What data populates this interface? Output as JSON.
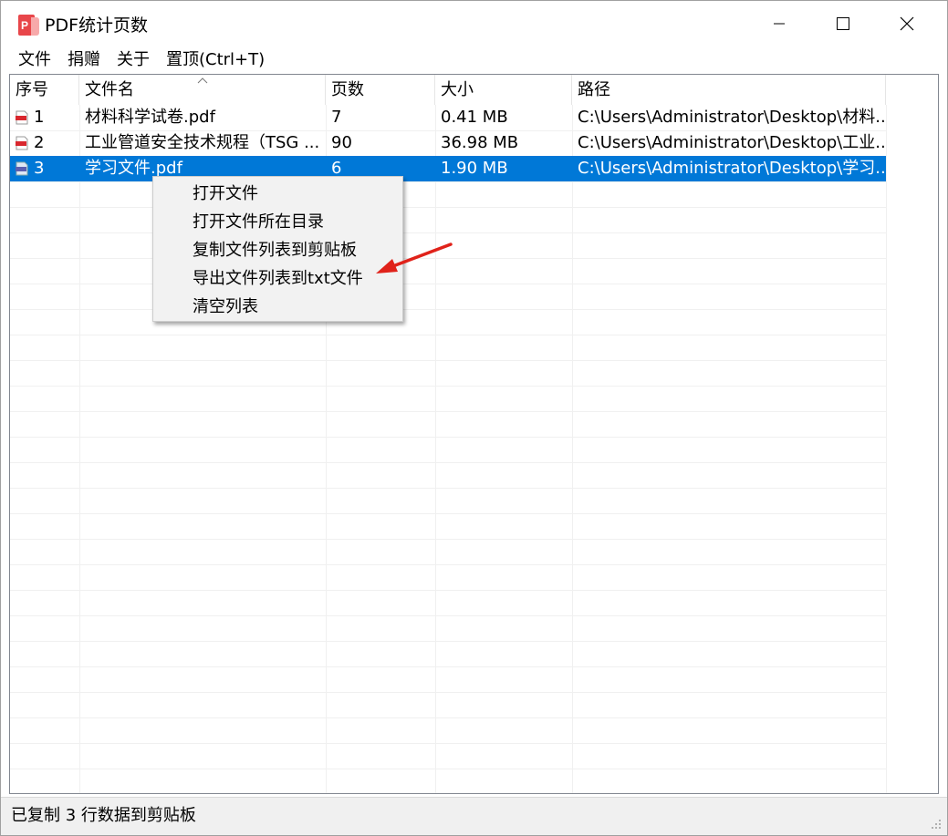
{
  "window": {
    "title": "PDF统计页数",
    "accent": "#0078d7"
  },
  "menu": [
    "文件",
    "捐赠",
    "关于",
    "置顶(Ctrl+T)"
  ],
  "columns": [
    "序号",
    "文件名",
    "页数",
    "大小",
    "路径"
  ],
  "rows": [
    {
      "index": "1",
      "name": "材料科学试卷.pdf",
      "pages": "7",
      "size": "0.41 MB",
      "path": "C:\\Users\\Administrator\\Desktop\\材料...",
      "selected": false,
      "icon": "pdf-file-icon"
    },
    {
      "index": "2",
      "name": "工业管道安全技术规程（TSG ...",
      "pages": "90",
      "size": "36.98 MB",
      "path": "C:\\Users\\Administrator\\Desktop\\工业...",
      "selected": false,
      "icon": "pdf-file-icon"
    },
    {
      "index": "3",
      "name": "学习文件.pdf",
      "pages": "6",
      "size": "1.90 MB",
      "path": "C:\\Users\\Administrator\\Desktop\\学习...",
      "selected": true,
      "icon": "pdf-file-icon"
    }
  ],
  "context_menu": [
    "打开文件",
    "打开文件所在目录",
    "复制文件列表到剪贴板",
    "导出文件列表到txt文件",
    "清空列表"
  ],
  "status": "已复制 3 行数据到剪贴板",
  "icons": {
    "app": "pdf-app-icon",
    "minimize": "minimize-icon",
    "maximize": "maximize-icon",
    "close": "close-icon",
    "sort": "sort-ascending-icon",
    "annotation": "red-arrow-icon",
    "grip": "resize-grip-icon"
  }
}
